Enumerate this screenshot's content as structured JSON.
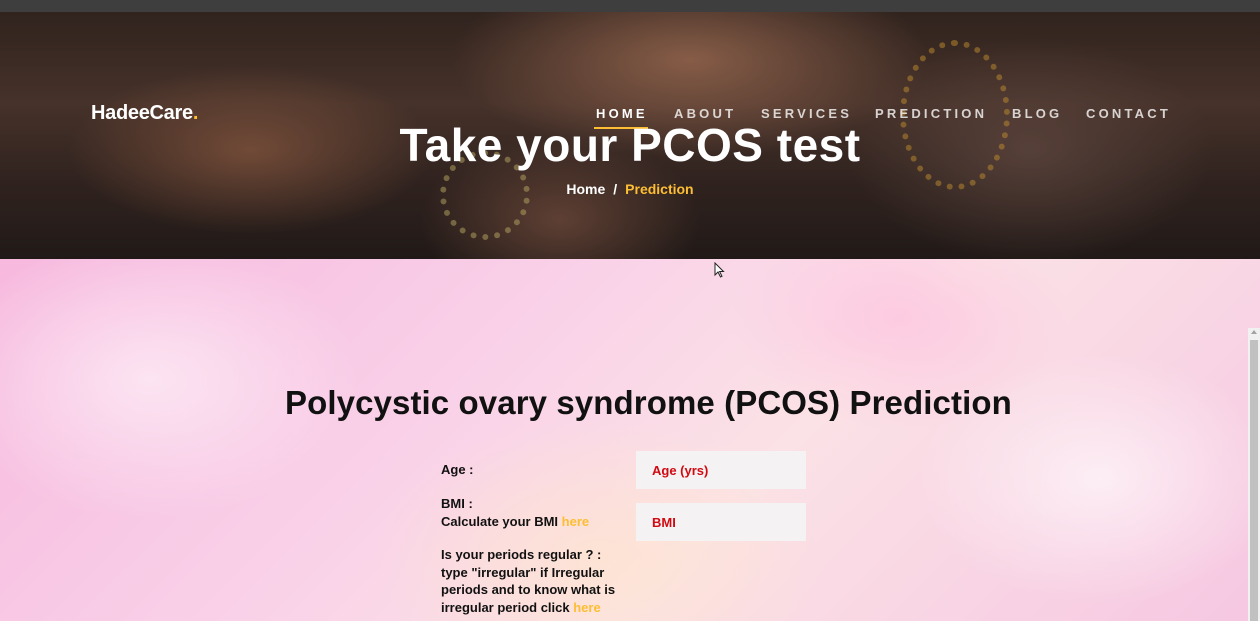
{
  "brand": {
    "name": "HadeeCare",
    "dot": "."
  },
  "nav": {
    "items": [
      {
        "label": "HOME",
        "active": true
      },
      {
        "label": "ABOUT",
        "active": false
      },
      {
        "label": "SERVICES",
        "active": false
      },
      {
        "label": "PREDICTION",
        "active": false
      },
      {
        "label": "BLOG",
        "active": false
      },
      {
        "label": "CONTACT",
        "active": false
      }
    ]
  },
  "hero": {
    "title": "Take your PCOS test",
    "breadcrumb": {
      "home": "Home",
      "separator": "/",
      "current": "Prediction"
    }
  },
  "form": {
    "title": "Polycystic ovary syndrome (PCOS) Prediction",
    "age": {
      "label": "Age :",
      "placeholder": "Age (yrs)"
    },
    "bmi": {
      "label": "BMI :",
      "hint": "Calculate your BMI",
      "link": "here",
      "placeholder": "BMI"
    },
    "periods": {
      "line1": "Is your periods regular ? :",
      "line2": "type \"irregular\" if Irregular",
      "line3": "periods and to know what is",
      "line4": "irregular period click",
      "link": "here"
    }
  },
  "colors": {
    "accent": "#fdbe33",
    "field_text": "#d10a11"
  }
}
